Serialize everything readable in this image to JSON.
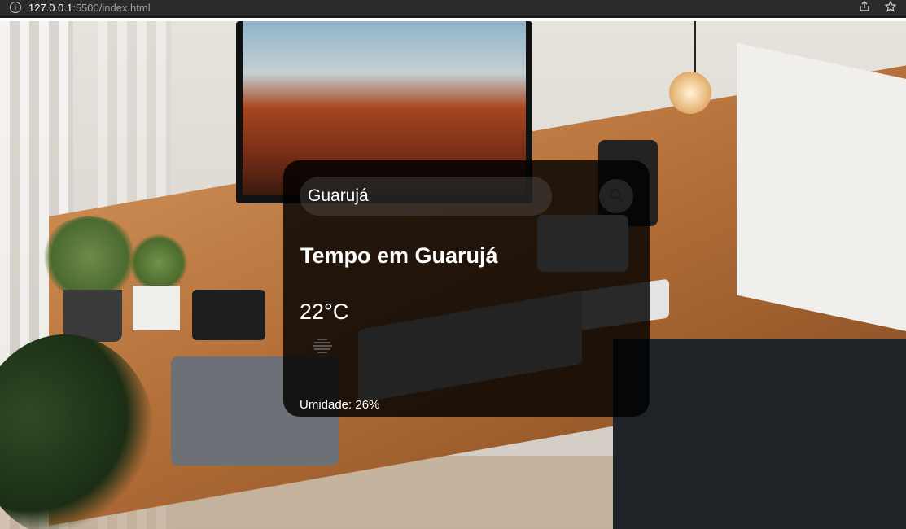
{
  "browser": {
    "url_host": "127.0.0.1",
    "url_path": ":5500/index.html"
  },
  "weather": {
    "search_value": "Guarujá",
    "title": "Tempo em Guarujá",
    "temperature": "22°C",
    "condition_icon": "mist-icon",
    "humidity": "Umidade: 26%"
  }
}
